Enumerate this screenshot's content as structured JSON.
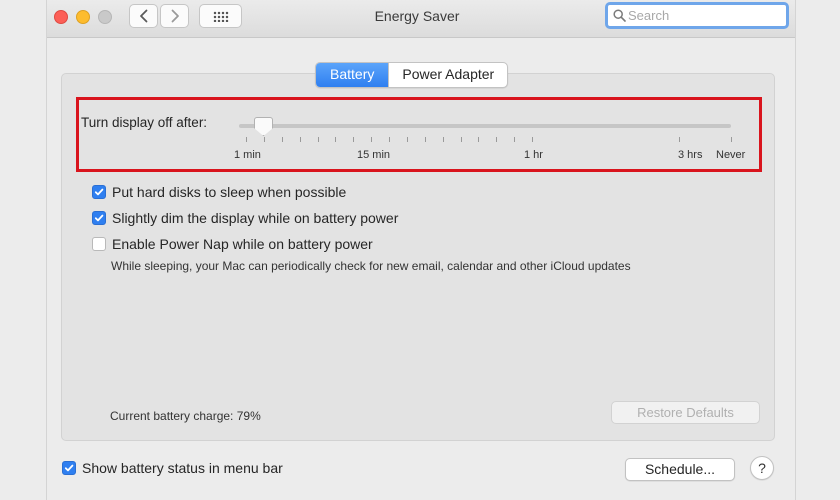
{
  "window": {
    "title": "Energy Saver",
    "search_placeholder": "Search"
  },
  "tabs": [
    {
      "label": "Battery",
      "selected": true
    },
    {
      "label": "Power Adapter",
      "selected": false
    }
  ],
  "display_sleep": {
    "label": "Turn display off after:",
    "selected_label": "1 min",
    "tick_labels": [
      "1 min",
      "15 min",
      "1 hr",
      "3 hrs",
      "Never"
    ]
  },
  "options": [
    {
      "label": "Put hard disks to sleep when possible",
      "checked": true
    },
    {
      "label": "Slightly dim the display while on battery power",
      "checked": true
    },
    {
      "label": "Enable Power Nap while on battery power",
      "checked": false
    }
  ],
  "power_nap_help": "While sleeping, your Mac can periodically check for new email, calendar and other iCloud updates",
  "battery_charge": "Current battery charge: 79%",
  "buttons": {
    "restore_defaults": "Restore Defaults",
    "schedule": "Schedule...",
    "help": "?"
  },
  "menu_bar_option": {
    "label": "Show battery status in menu bar",
    "checked": true
  },
  "colors": {
    "accent": "#2f7ff0",
    "highlight_box": "#d9141d",
    "close": "#fc5f57",
    "minimize": "#fdbc2e"
  }
}
